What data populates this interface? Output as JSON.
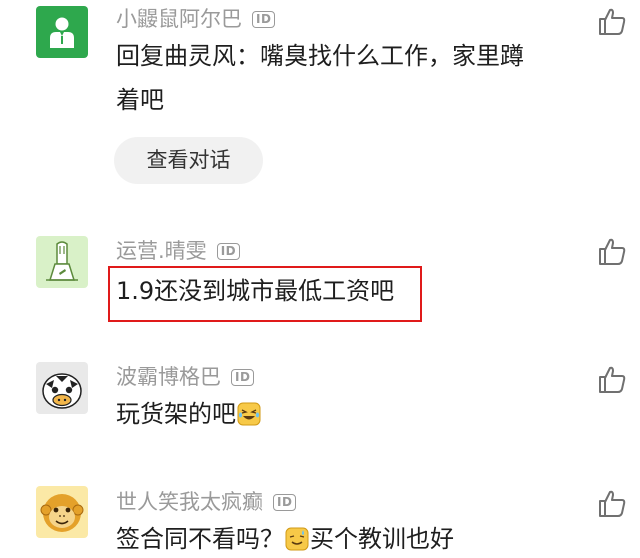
{
  "comments": [
    {
      "username": "小鼹鼠阿尔巴",
      "badge": "ID",
      "text_line1": "回复曲灵风：嘴臭找什么工作，家里蹲",
      "text_line2": "着吧",
      "view_thread_label": "查看对话"
    },
    {
      "username": "运营.晴雯",
      "badge": "ID",
      "text": "1.9还没到城市最低工资吧"
    },
    {
      "username": "波霸博格巴",
      "badge": "ID",
      "text": "玩货架的吧"
    },
    {
      "username": "世人笑我太疯癫",
      "badge": "ID",
      "text_before_emoji": "签合同不看吗？",
      "text_after_emoji": "买个教训也好"
    }
  ],
  "colors": {
    "username": "#9a9a9a",
    "text": "#1e1e1e",
    "highlight_border": "#e01a1a",
    "button_bg": "#f1f1f1",
    "avatar1_bg": "#2ea84d",
    "avatar2_bg": "#d9f1c8"
  },
  "icons": {
    "like": "thumbs-up-outline-icon",
    "emoji_comment3": "laughing-tears-emoji",
    "emoji_comment4": "sweat-smile-emoji"
  }
}
